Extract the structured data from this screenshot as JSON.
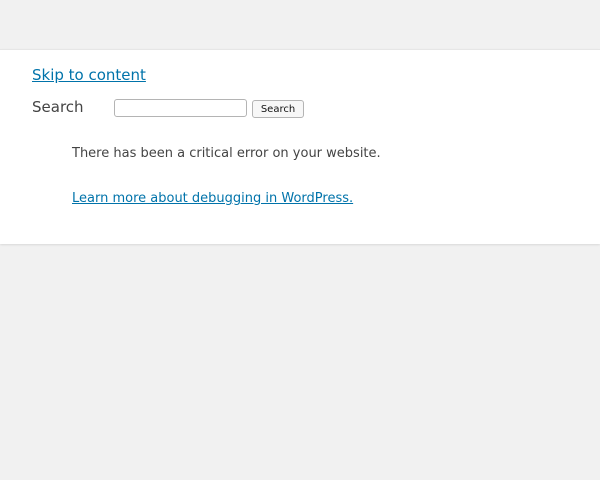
{
  "skip_link": "Skip to content",
  "search": {
    "label": "Search",
    "input_value": "",
    "button_label": "Search"
  },
  "error": {
    "message": "There has been a critical error on your website.",
    "learn_more_link": "Learn more about debugging in WordPress."
  },
  "colors": {
    "link": "#0073aa",
    "text": "#444444",
    "page_background": "#f1f1f1",
    "panel_background": "#ffffff"
  }
}
